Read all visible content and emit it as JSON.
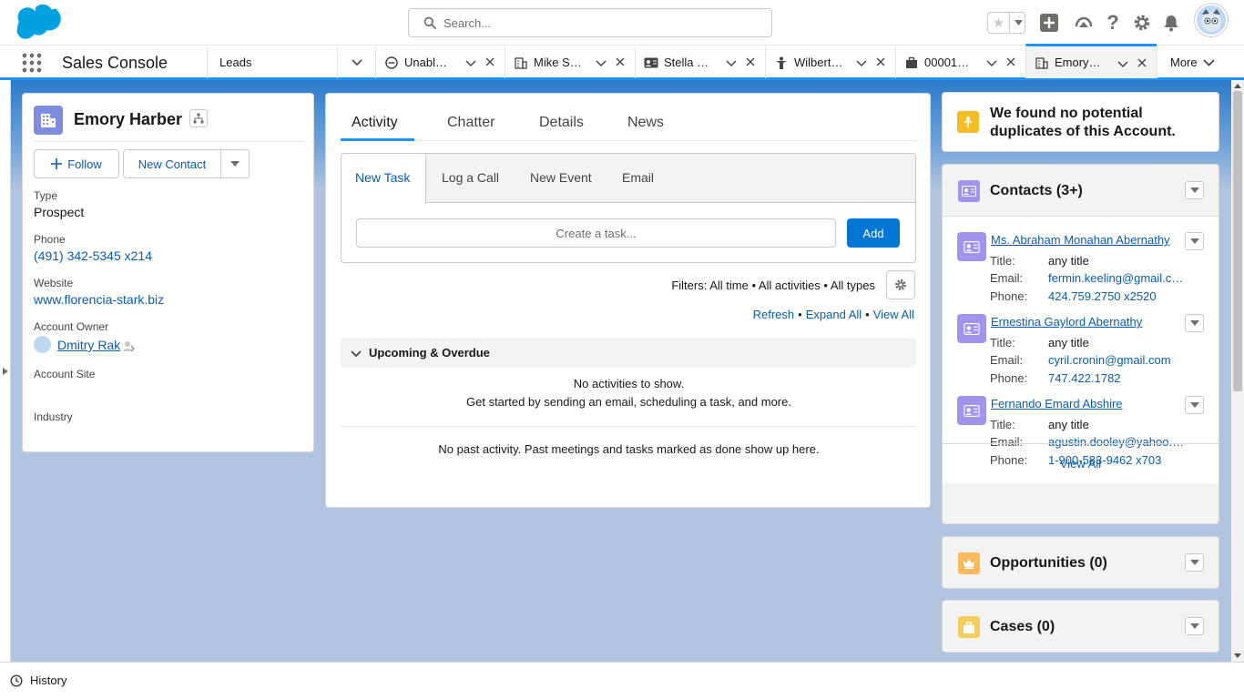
{
  "header": {
    "search_placeholder": "Search..."
  },
  "nav": {
    "app_name": "Sales Console",
    "tabs": [
      {
        "label": "Leads",
        "icon": "none"
      },
      {
        "label": "Unabl…",
        "icon": "unavailable-icon"
      },
      {
        "label": "Mike S…",
        "icon": "account-icon"
      },
      {
        "label": "Stella …",
        "icon": "contact-card-icon"
      },
      {
        "label": "Wilbert…",
        "icon": "person-icon"
      },
      {
        "label": "00001…",
        "icon": "briefcase-icon"
      },
      {
        "label": "Emory…",
        "icon": "account-icon"
      }
    ],
    "more_label": "More"
  },
  "account": {
    "name": "Emory Harber",
    "follow_label": "Follow",
    "new_contact_label": "New Contact",
    "fields": {
      "type_label": "Type",
      "type_value": "Prospect",
      "phone_label": "Phone",
      "phone_value": "(491) 342-5345 x214",
      "website_label": "Website",
      "website_value": "www.florencia-stark.biz",
      "owner_label": "Account Owner",
      "owner_value": "Dmitry Rak",
      "site_label": "Account Site",
      "industry_label": "Industry"
    }
  },
  "activity": {
    "tabs": [
      "Activity",
      "Chatter",
      "Details",
      "News"
    ],
    "composer_tabs": [
      "New Task",
      "Log a Call",
      "New Event",
      "Email"
    ],
    "task_placeholder": "Create a task...",
    "add_label": "Add",
    "filters_text": "Filters: All time • All activities • All types",
    "refresh_label": "Refresh",
    "expand_all_label": "Expand All",
    "view_all_label": "View All",
    "upcoming_label": "Upcoming & Overdue",
    "no_activities": "No activities to show.",
    "get_started": "Get started by sending an email, scheduling a task, and more.",
    "no_past": "No past activity. Past meetings and tasks marked as done show up here."
  },
  "right": {
    "duplicates_text": "We found no potential duplicates of this Account.",
    "contacts_title": "Contacts (3+)",
    "contacts": [
      {
        "name": "Ms. Abraham Monahan Abernathy",
        "title_label": "Title:",
        "title": "any title",
        "email_label": "Email:",
        "email": "fermin.keeling@gmail.c…",
        "phone_label": "Phone:",
        "phone": "424.759.2750 x2520"
      },
      {
        "name": "Ernestina Gaylord Abernathy",
        "title_label": "Title:",
        "title": "any title",
        "email_label": "Email:",
        "email": "cyril.cronin@gmail.com",
        "phone_label": "Phone:",
        "phone": "747.422.1782"
      },
      {
        "name": "Fernando Emard Abshire",
        "title_label": "Title:",
        "title": "any title",
        "email_label": "Email:",
        "email": "agustin.dooley@yahoo.…",
        "phone_label": "Phone:",
        "phone": "1-900-583-9462 x703"
      }
    ],
    "contacts_view_all": "View All",
    "opportunities_title": "Opportunities (0)",
    "cases_title": "Cases (0)",
    "colors": {
      "contacts": "#a094ed",
      "opportunities": "#fcb95b",
      "cases": "#f2cf5b",
      "duplicates": "#f4bc25"
    }
  },
  "utility": {
    "history_label": "History"
  }
}
